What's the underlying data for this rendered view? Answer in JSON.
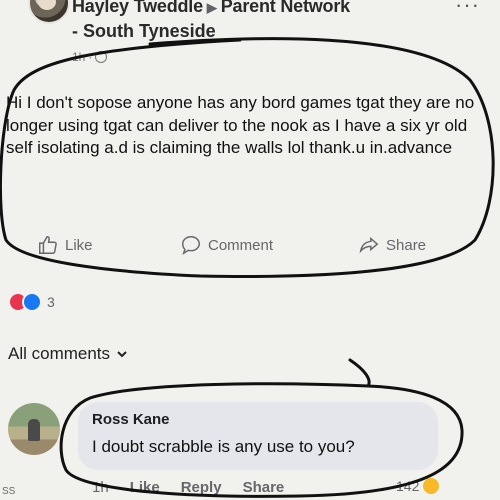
{
  "post": {
    "author": "Hayley Tweddle",
    "group_line1": "Parent Network",
    "group_line2": "- South Tyneside",
    "time": "1h",
    "text": "Hi I don't sopose anyone has any bord games tgat they are no longer using tgat can deliver to the nook as I have a six yr old self isolating a.d is claiming the walls lol  thank.u in.advance"
  },
  "actions": {
    "like": "Like",
    "comment": "Comment",
    "share": "Share"
  },
  "reactions": {
    "count": "3"
  },
  "all_comments": "All comments",
  "comment": {
    "name": "Ross Kane",
    "text": "I doubt scrabble is any use to you?",
    "time": "1h",
    "like": "Like",
    "reply": "Reply",
    "share": "Share",
    "reaction_count": "142"
  },
  "watermark": "SS",
  "colors": {
    "link": "#65676b",
    "love": "#e8344e",
    "like": "#1877f2",
    "ink": "#111111"
  }
}
